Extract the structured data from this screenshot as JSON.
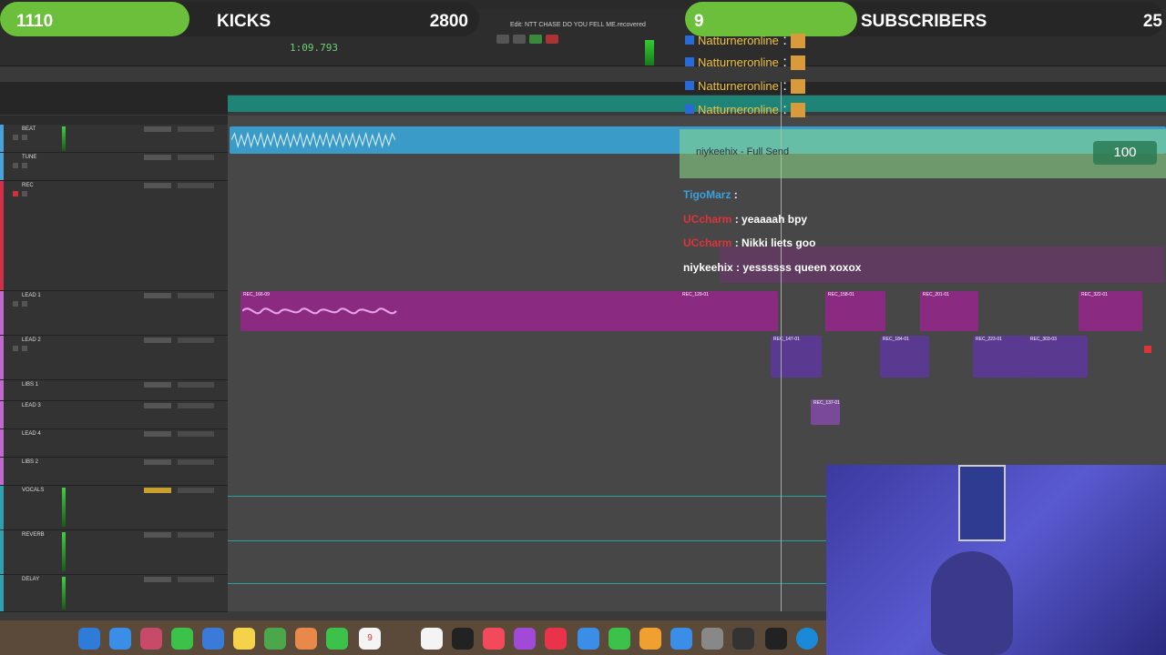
{
  "overlay": {
    "kicks_count": "1110",
    "kicks_label": "KICKS",
    "kicks_goal": "2800",
    "kicks_progress": 0.396,
    "subs_count": "9",
    "subs_label": "SUBSCRIBERS",
    "subs_goal": "25",
    "subs_progress": 0.36
  },
  "window": {
    "title": "Edit: NTT CHASE DO YOU FELL ME.recovered",
    "counter": "1:09.793"
  },
  "tracks": [
    {
      "name": "BEAT",
      "color": "#4aa0d8"
    },
    {
      "name": "TUNE",
      "color": "#4aa0d8"
    },
    {
      "name": "REC",
      "color": "#d0304a"
    },
    {
      "name": "LEAD 1",
      "color": "#c06ad0"
    },
    {
      "name": "LEAD 2",
      "color": "#c06ad0"
    },
    {
      "name": "LIBS 1",
      "color": "#c06ad0"
    },
    {
      "name": "LEAD 3",
      "color": "#c06ad0"
    },
    {
      "name": "LEAD 4",
      "color": "#c06ad0"
    },
    {
      "name": "LIBS 2",
      "color": "#c06ad0"
    },
    {
      "name": "VOCALS",
      "color": "#30a0b0"
    },
    {
      "name": "REVERB",
      "color": "#30a0b0"
    },
    {
      "name": "DELAY",
      "color": "#30a0b0"
    }
  ],
  "clips": {
    "lead1": [
      "REC_166-09",
      "REC_129-01",
      "REC_158-01",
      "REC_201-01",
      "REC_322-01"
    ],
    "lead2": [
      "REC_147-01",
      "REC_184-01",
      "REC_223-01",
      "REC_303-03"
    ],
    "libs": [
      "REC_137-01"
    ]
  },
  "chat": {
    "repeated_user": "Natturneronline",
    "separator": ":",
    "banner_user": "niykeehix",
    "banner_text": "- Full Send",
    "banner_points": "100",
    "messages": [
      {
        "user": "TigoMarz",
        "sep": ":",
        "text": "",
        "color": "#3aa0d8"
      },
      {
        "user": "UCcharm",
        "sep": ":",
        "text": "yeaaaah bpy",
        "color": "#e0333a"
      },
      {
        "user": "UCcharm",
        "sep": ":",
        "text": "Nikki liets goo",
        "color": "#e0333a"
      },
      {
        "user": "niykeehix",
        "sep": ":",
        "text": "yessssss queen xoxox",
        "color": "#ffffff"
      }
    ]
  },
  "dock": {
    "calendar_day": "9"
  }
}
